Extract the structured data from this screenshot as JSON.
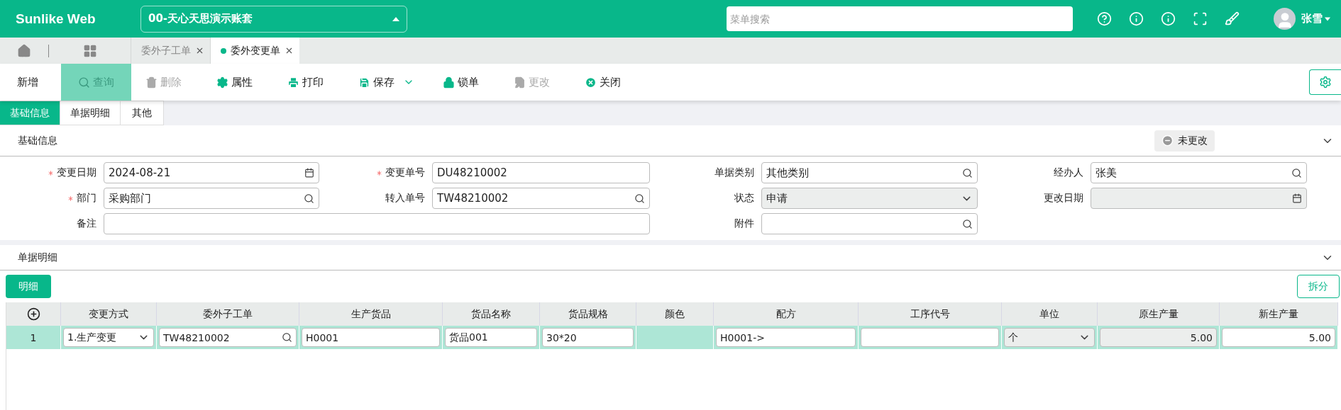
{
  "header": {
    "logo": "Sunlike Web",
    "account": "00-天心天思演示账套",
    "search": {
      "placeholder": "菜单搜索"
    },
    "icons": [
      {
        "kind": "help"
      },
      {
        "kind": "info"
      },
      {
        "kind": "info"
      },
      {
        "kind": "fullscreen"
      },
      {
        "kind": "clean"
      }
    ],
    "user": "张雪"
  },
  "page_tabs": [
    {
      "label": "委外子工单",
      "selected": false
    },
    {
      "label": "委外变更单",
      "selected": true
    }
  ],
  "toolbar": [
    {
      "label": "新增",
      "kind": "none",
      "disabled": false,
      "selected": false
    },
    {
      "label": "查询",
      "kind": "search",
      "disabled": false,
      "selected": true
    },
    {
      "label": "删除",
      "kind": "delete",
      "disabled": true,
      "selected": false
    },
    {
      "label": "属性",
      "kind": "settings",
      "disabled": false,
      "selected": false
    },
    {
      "label": "打印",
      "kind": "print",
      "disabled": false,
      "selected": false
    },
    {
      "label": "保存",
      "kind": "save",
      "disabled": false,
      "selected": false
    },
    {
      "label": "锁单",
      "kind": "lock",
      "disabled": false,
      "selected": false
    },
    {
      "label": "更改",
      "kind": "edit",
      "disabled": true,
      "selected": false
    },
    {
      "label": "关闭",
      "kind": "close",
      "disabled": false,
      "selected": false
    }
  ],
  "form_tabs": [
    {
      "label": "基础信息",
      "selected": true
    },
    {
      "label": "单据明细",
      "selected": false
    },
    {
      "label": "其他",
      "selected": false
    }
  ],
  "basic_section": {
    "title": "基础信息",
    "status": "未更改",
    "expanded": true
  },
  "fields": [
    {
      "label": "变更日期",
      "value": "2024-08-21",
      "kind": "date",
      "required": true,
      "disabled": false
    },
    {
      "label": "变更单号",
      "value": "DU48210002",
      "kind": "text",
      "required": true,
      "disabled": false
    },
    {
      "label": "单据类别",
      "value": "其他类别",
      "kind": "search",
      "required": false,
      "disabled": false
    },
    {
      "label": "经办人",
      "value": "张美",
      "kind": "search",
      "required": false,
      "disabled": false
    },
    {
      "label": "部门",
      "value": "采购部门",
      "kind": "search",
      "required": true,
      "disabled": false
    },
    {
      "label": "转入单号",
      "value": "TW48210002",
      "kind": "search",
      "required": false,
      "disabled": false
    },
    {
      "label": "状态",
      "value": "申请",
      "kind": "select",
      "required": false,
      "disabled": true
    },
    {
      "label": "更改日期",
      "kind": "date",
      "required": false,
      "disabled": true
    },
    {
      "label": "备注",
      "kind": "wide",
      "required": false,
      "disabled": false
    },
    {
      "label": "附件",
      "kind": "search",
      "required": false,
      "disabled": false
    }
  ],
  "detail_section": {
    "title": "单据明细",
    "expanded": true,
    "button": "明细",
    "split_button": "拆分"
  },
  "table": {
    "columns": [
      "变更方式",
      "委外子工单",
      "生产货品",
      "货品名称",
      "货品规格",
      "颜色",
      "配方",
      "工序代号",
      "单位",
      "原生产量",
      "新生产量"
    ],
    "rows": [
      {
        "number": "1",
        "selected": true,
        "cells": [
          {
            "kind": "select",
            "value": "1.生产变更",
            "disabled": false
          },
          {
            "kind": "search",
            "value": "TW48210002",
            "disabled": false
          },
          {
            "kind": "input",
            "value": "H0001",
            "disabled": false
          },
          {
            "kind": "input",
            "value": "货品001",
            "disabled": false
          },
          {
            "kind": "input",
            "value": "30*20",
            "disabled": false
          },
          {
            "kind": "empty"
          },
          {
            "kind": "input",
            "value": "H0001->",
            "disabled": false
          },
          {
            "kind": "input",
            "disabled": false
          },
          {
            "kind": "select",
            "value": "个",
            "disabled": true
          },
          {
            "kind": "number",
            "value": "5.00",
            "disabled": true
          },
          {
            "kind": "number",
            "value": "5.00",
            "disabled": false
          }
        ]
      }
    ]
  }
}
